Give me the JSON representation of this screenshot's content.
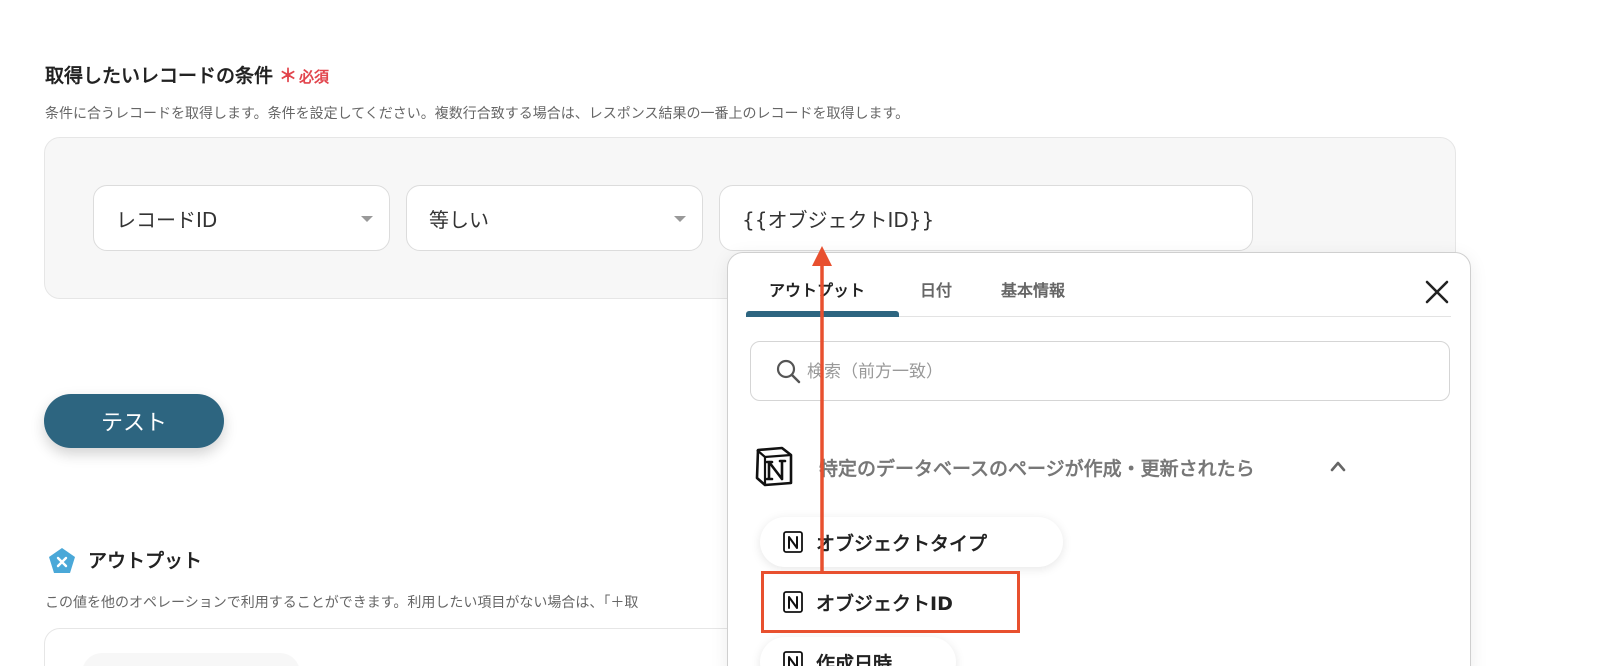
{
  "condition": {
    "title": "取得したいレコードの条件",
    "required_star": "＊",
    "required_label": "必須",
    "description": "条件に合うレコードを取得します。条件を設定してください。複数行合致する場合は、レスポンス結果の一番上のレコードを取得します。",
    "field_key": "レコードID",
    "operator": "等しい",
    "value": "{{オブジェクトID}}"
  },
  "test_button": "テスト",
  "output": {
    "icon": "x-pentagon-icon",
    "title": "アウトプット",
    "description": "この値を他のオペレーションで利用することができます。利用したい項目がない場合は、「＋取"
  },
  "panel": {
    "tabs": [
      {
        "label": "アウトプット",
        "active": true
      },
      {
        "label": "日付",
        "active": false
      },
      {
        "label": "基本情報",
        "active": false
      }
    ],
    "search_placeholder": "検索（前方一致）",
    "group_label": "特定のデータベースのページが作成・更新されたら",
    "items": [
      {
        "label": "オブジェクトタイプ"
      },
      {
        "label": "オブジェクトID"
      },
      {
        "label": "作成日時"
      }
    ]
  },
  "colors": {
    "primary": "#2d6580",
    "required": "#e2454d",
    "annotation": "#e8502f"
  }
}
